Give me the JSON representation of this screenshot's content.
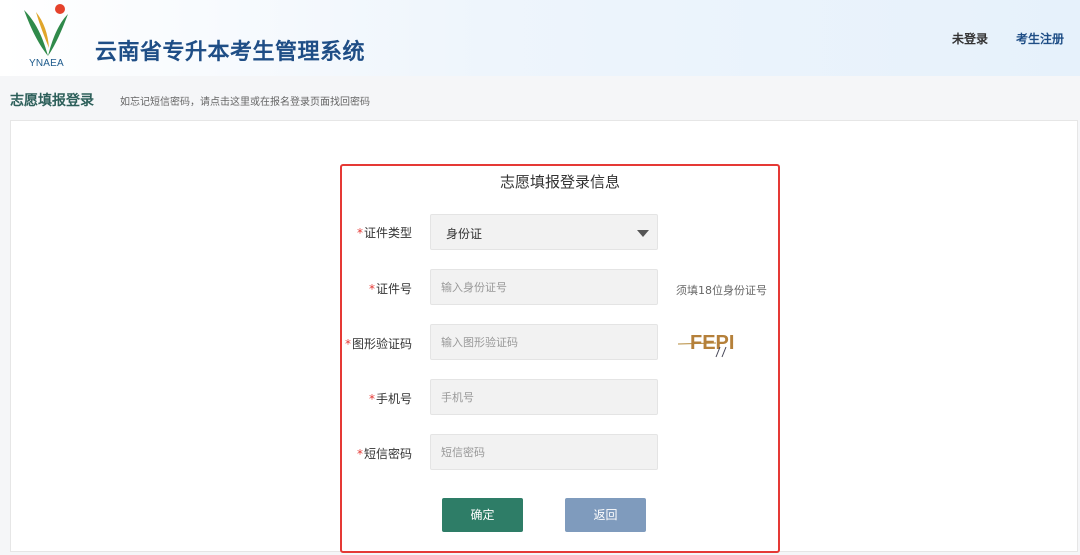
{
  "header": {
    "logo_text": "YNAEA",
    "system_title": "云南省专升本考生管理系统",
    "not_logged_in": "未登录",
    "register": "考生注册"
  },
  "subbar": {
    "title": "志愿填报登录",
    "hint": "如忘记短信密码，请点击这里或在报名登录页面找回密码"
  },
  "form": {
    "title": "志愿填报登录信息",
    "required_mark": "*",
    "id_type": {
      "label": "证件类型",
      "value": "身份证"
    },
    "id_number": {
      "label": "证件号",
      "placeholder": "输入身份证号",
      "hint": "须填18位身份证号"
    },
    "captcha": {
      "label": "图形验证码",
      "placeholder": "输入图形验证码",
      "image_text": "FEPI"
    },
    "phone": {
      "label": "手机号",
      "placeholder": "手机号"
    },
    "sms_password": {
      "label": "短信密码",
      "placeholder": "短信密码"
    },
    "confirm_button": "确定",
    "back_button": "返回"
  },
  "colors": {
    "brand_blue": "#1f4e86",
    "required_red": "#e53935",
    "confirm_green": "#2e7d67",
    "back_blue": "#7f9bbd"
  }
}
